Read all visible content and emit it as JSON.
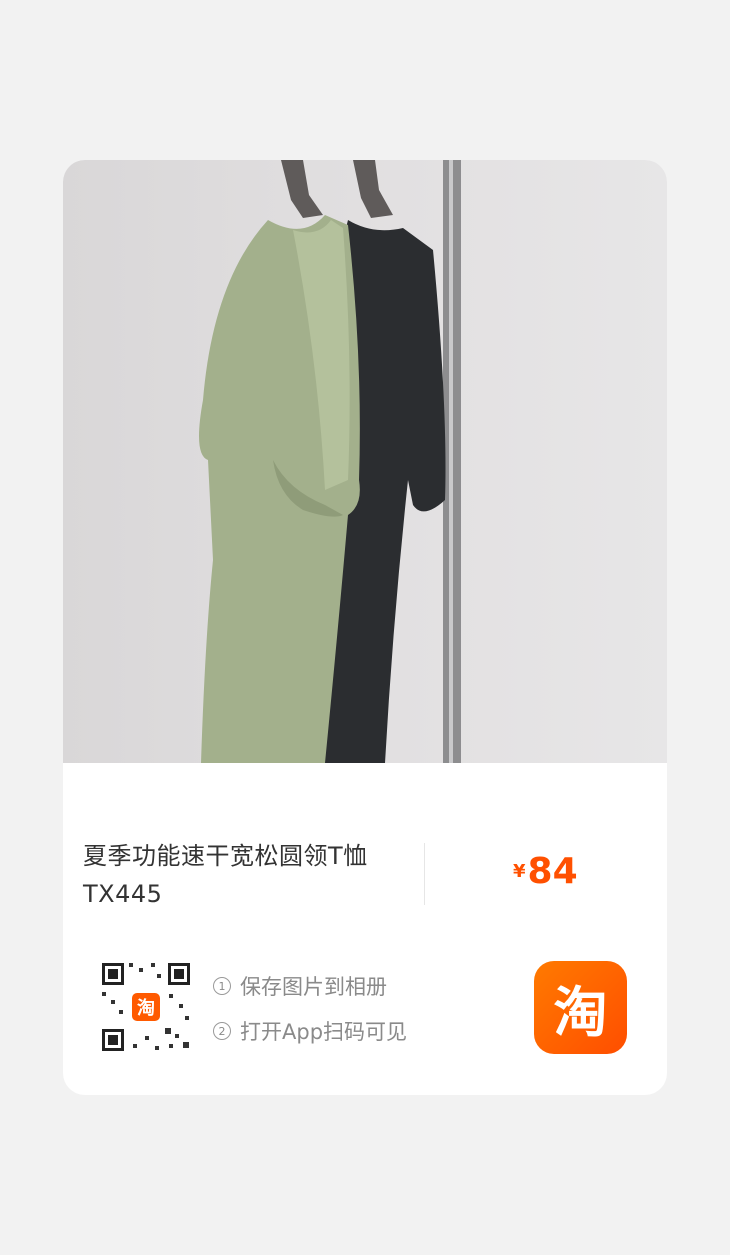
{
  "product": {
    "title_line1": "夏季功能速干宽松圆领T恤",
    "title_line2": "TX445",
    "price_currency": "¥",
    "price_amount": "84"
  },
  "share": {
    "step1_num": "1",
    "step1_text": "保存图片到相册",
    "step2_num": "2",
    "step2_text": "打开App扫码可见",
    "qr_logo_char": "淘",
    "app_icon_char": "淘"
  },
  "colors": {
    "price": "#ff5000",
    "taobao_orange": "#ff5a00",
    "shirt_green": "#a3b08c",
    "shirt_black": "#2b2d30"
  }
}
